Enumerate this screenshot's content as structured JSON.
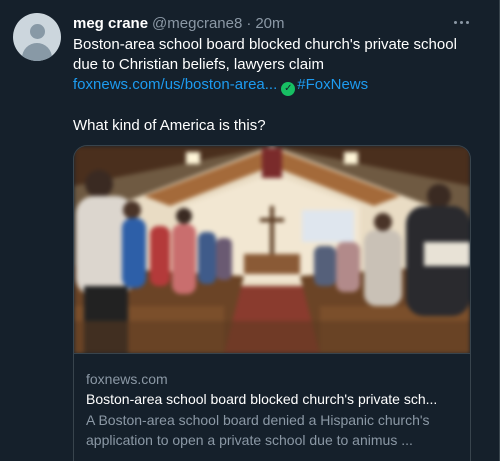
{
  "tweet": {
    "author_name": "meg crane",
    "author_handle": "@megcrane8",
    "separator": "·",
    "time": "20m",
    "text_line1": "Boston-area school board blocked church's private school",
    "text_line2": "due to Christian beliefs, lawyers claim",
    "link": "foxnews.com/us/boston-area...",
    "hashtag": "#FoxNews",
    "question": "What kind of America is this?"
  },
  "card": {
    "domain": "foxnews.com",
    "title": "Boston-area school board blocked church's private sch...",
    "description_line1": "A Boston-area school board denied a Hispanic church's",
    "description_line2": "application to open a private school due to animus ..."
  },
  "colors": {
    "background": "#15202b",
    "link": "#1d9bf0",
    "muted": "#8b98a5",
    "border": "#38444d"
  }
}
